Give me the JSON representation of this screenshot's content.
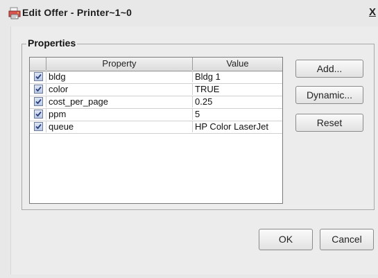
{
  "window": {
    "title": "Edit Offer - Printer~1~0",
    "close_label": "X"
  },
  "properties": {
    "group_title": "Properties",
    "columns": [
      "",
      "Property",
      "Value"
    ],
    "rows": [
      {
        "checked": true,
        "property": "bldg",
        "value": "Bldg 1"
      },
      {
        "checked": true,
        "property": "color",
        "value": "TRUE"
      },
      {
        "checked": true,
        "property": "cost_per_page",
        "value": "0.25"
      },
      {
        "checked": true,
        "property": "ppm",
        "value": "5"
      },
      {
        "checked": true,
        "property": "queue",
        "value": "HP Color LaserJet"
      }
    ]
  },
  "side_buttons": {
    "add": "Add...",
    "dynamic": "Dynamic...",
    "reset": "Reset"
  },
  "footer": {
    "ok": "OK",
    "cancel": "Cancel"
  },
  "icons": {
    "app": "printer-app-icon",
    "check": "checkmark-icon"
  }
}
